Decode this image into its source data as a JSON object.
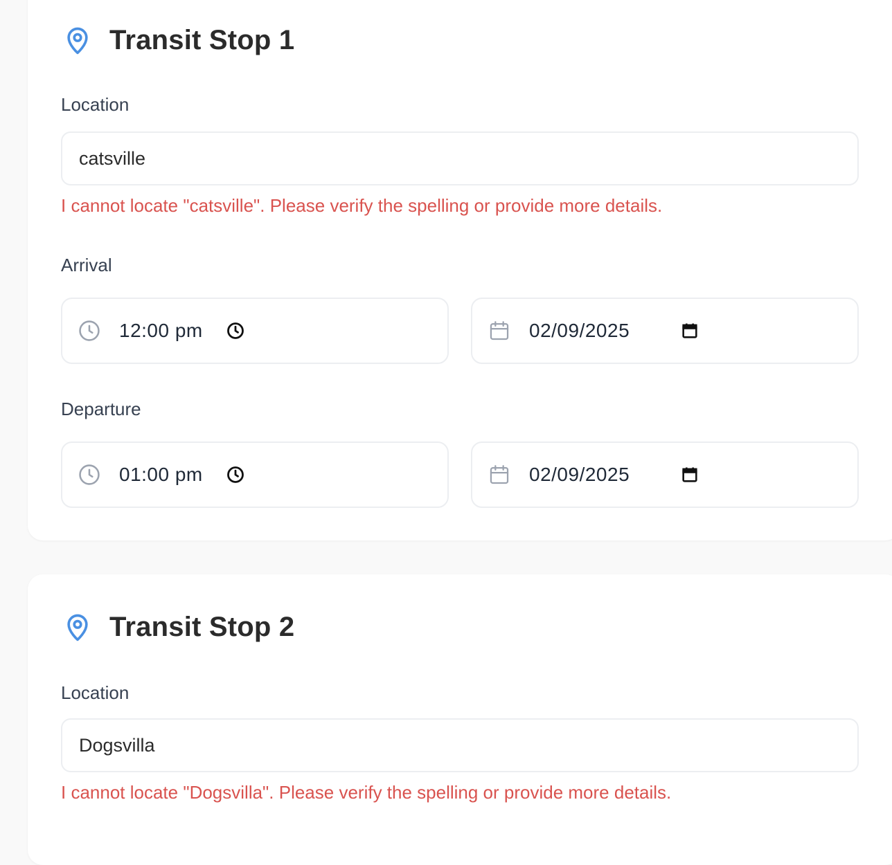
{
  "stops": [
    {
      "title": "Transit Stop 1",
      "location_label": "Location",
      "location_value": "catsville",
      "error": "I cannot locate \"catsville\". Please verify the spelling or provide more details.",
      "arrival_label": "Arrival",
      "arrival_time": "12:00 pm",
      "arrival_date": "02/09/2025",
      "departure_label": "Departure",
      "departure_time": "01:00 pm",
      "departure_date": "02/09/2025"
    },
    {
      "title": "Transit Stop 2",
      "location_label": "Location",
      "location_value": "Dogsvilla",
      "error": "I cannot locate \"Dogsvilla\". Please verify the spelling or provide more details."
    }
  ],
  "icons": {
    "stop_icon": "map-pin-icon",
    "time_lead": "clock-icon",
    "date_lead": "calendar-icon",
    "time_picker": "clock-picker-icon",
    "date_picker": "calendar-picker-icon"
  },
  "colors": {
    "accent": "#4a90e2",
    "error": "#d9534f",
    "background": "#f9f9f9",
    "card": "#ffffff"
  }
}
